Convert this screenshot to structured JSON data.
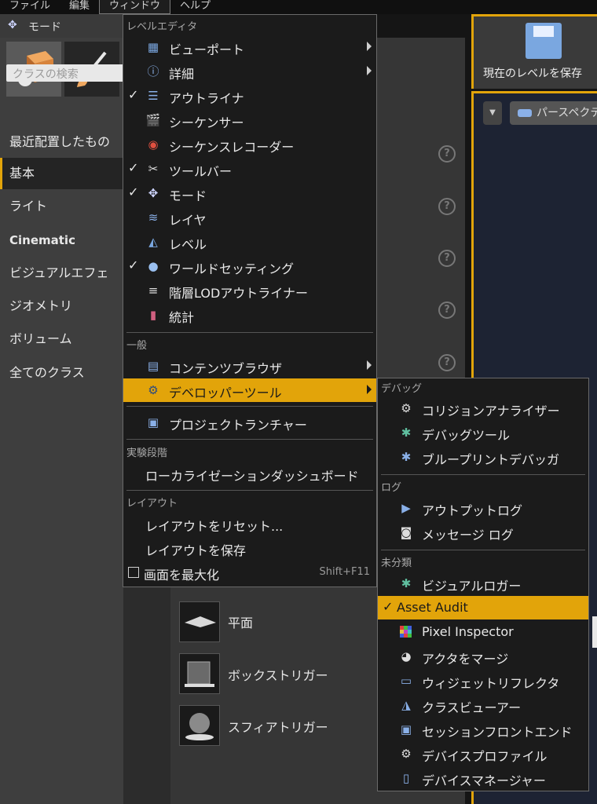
{
  "menubar": {
    "file": "ファイル",
    "edit": "編集",
    "window": "ウィンドウ",
    "help": "ヘルプ"
  },
  "modes": {
    "tab_label": "モード",
    "search_placeholder": "クラスの検索",
    "categories": [
      "最近配置したもの",
      "基本",
      "ライト",
      "Cinematic",
      "ビジュアルエフェ",
      "ジオメトリ",
      "ボリューム",
      "全てのクラス"
    ],
    "assets": [
      "平面",
      "ボックストリガー",
      "スフィアトリガー"
    ]
  },
  "toolbar": {
    "save_label": "現在のレベルを保存"
  },
  "viewport": {
    "perspective": "パースペクティブ"
  },
  "window_menu": {
    "sec_level_editor": "レベルエディタ",
    "viewport": "ビューポート",
    "details": "詳細",
    "outliner": "アウトライナ",
    "sequencer": "シーケンサー",
    "sequence_recorder": "シーケンスレコーダー",
    "toolbar": "ツールバー",
    "modes": "モード",
    "layers": "レイヤ",
    "levels": "レベル",
    "world_settings": "ワールドセッティング",
    "hlod_outliner": "階層LODアウトライナー",
    "statistics": "統計",
    "sec_general": "一般",
    "content_browser": "コンテンツブラウザ",
    "developer_tools": "デベロッパーツール",
    "project_launcher": "プロジェクトランチャー",
    "sec_experimental": "実験段階",
    "localization_dashboard": "ローカライゼーションダッシュボード",
    "sec_layout": "レイアウト",
    "reset_layout": "レイアウトをリセット...",
    "save_layout": "レイアウトを保存",
    "maximize": "画面を最大化",
    "maximize_shortcut": "Shift+F11"
  },
  "dev_menu": {
    "sec_debug": "デバッグ",
    "collision_analyzer": "コリジョンアナライザー",
    "debug_tools": "デバッグツール",
    "blueprint_debugger": "ブループリントデバッガ",
    "sec_log": "ログ",
    "output_log": "アウトプットログ",
    "message_log": "メッセージ ログ",
    "sec_misc": "未分類",
    "visual_logger": "ビジュアルロガー",
    "asset_audit": "Asset Audit",
    "pixel_inspector": "Pixel Inspector",
    "merge_actors": "アクタをマージ",
    "widget_reflector": "ウィジェットリフレクタ",
    "class_viewer": "クラスビューアー",
    "session_frontend": "セッションフロントエンド",
    "device_profiles": "デバイスプロファイル",
    "device_manager": "デバイスマネージャー"
  },
  "colors": {
    "accent": "#e2a40a",
    "menu_bg": "#1b1b1b",
    "panel_bg": "#3e3e3e"
  }
}
